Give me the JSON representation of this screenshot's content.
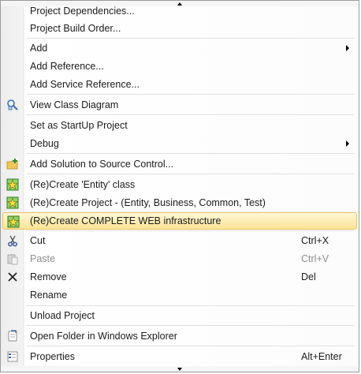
{
  "menu": {
    "items": [
      {
        "label": "Project Dependencies...",
        "icon": null
      },
      {
        "label": "Project Build Order...",
        "icon": null
      },
      {
        "label": "Add",
        "submenu": true
      },
      {
        "label": "Add Reference..."
      },
      {
        "label": "Add Service Reference..."
      },
      {
        "label": "View Class Diagram",
        "icon": "class-diagram-icon"
      },
      {
        "label": "Set as StartUp Project"
      },
      {
        "label": "Debug",
        "submenu": true
      },
      {
        "label": "Add Solution to Source Control...",
        "icon": "folder-add-icon"
      },
      {
        "label": "(Re)Create 'Entity' class",
        "icon": "star-chart-icon"
      },
      {
        "label": "(Re)Create Project - (Entity, Business, Common, Test)",
        "icon": "star-chart-icon"
      },
      {
        "label": "(Re)Create COMPLETE WEB infrastructure",
        "icon": "star-chart-icon",
        "highlighted": true
      },
      {
        "label": "Cut",
        "shortcut": "Ctrl+X",
        "icon": "scissors-icon"
      },
      {
        "label": "Paste",
        "shortcut": "Ctrl+V",
        "icon": "paste-icon",
        "disabled": true
      },
      {
        "label": "Remove",
        "shortcut": "Del",
        "icon": "close-icon"
      },
      {
        "label": "Rename"
      },
      {
        "label": "Unload Project"
      },
      {
        "label": "Open Folder in Windows Explorer",
        "icon": "open-folder-icon"
      },
      {
        "label": "Properties",
        "shortcut": "Alt+Enter",
        "icon": "properties-icon"
      }
    ]
  },
  "colors": {
    "highlight_top": "#fff7d8",
    "highlight_bottom": "#fbe493",
    "highlight_border": "#e5c365",
    "disabled_text": "#8d8d8d"
  }
}
